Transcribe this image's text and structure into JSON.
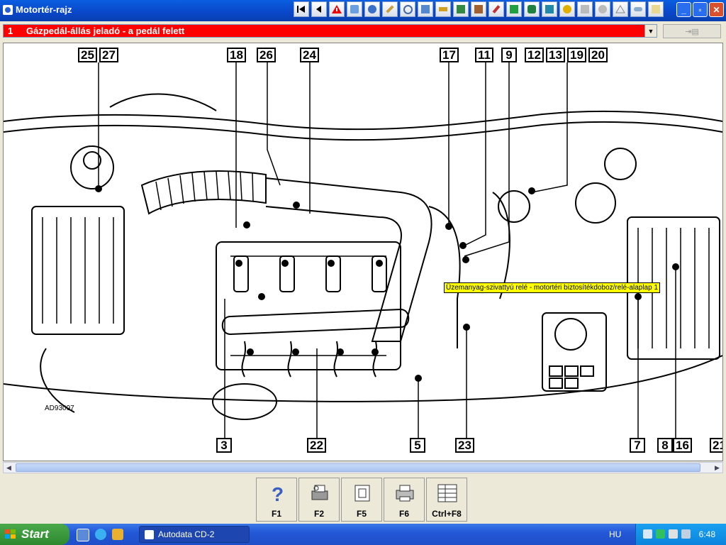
{
  "window": {
    "title": "Motortér-rajz"
  },
  "toolbar": {
    "icons": [
      "first-icon",
      "prev-icon",
      "warning-icon",
      "tool-icon",
      "gear-icon",
      "wrench-icon",
      "gauge-icon",
      "diagram-icon",
      "filter-icon",
      "battery-icon",
      "engine-icon",
      "pencil-icon",
      "relay-icon",
      "connector-icon",
      "circuit-icon",
      "key-icon",
      "hand-icon",
      "bulb-icon",
      "triangle-icon",
      "car-icon",
      "info-icon"
    ]
  },
  "window_buttons": {
    "minimize": "_",
    "maximize": "▫",
    "close": "✕"
  },
  "component_select": {
    "number": "1",
    "value": "Gázpedál-állás jeladó - a pedál felett"
  },
  "drawing": {
    "code": "AD93097",
    "labels_top": [
      "25",
      "27",
      "18",
      "26",
      "24",
      "17",
      "11",
      "9",
      "12",
      "13",
      "19",
      "20"
    ],
    "labels_bottom": [
      "3",
      "22",
      "5",
      "23",
      "7",
      "8",
      "16",
      "21"
    ],
    "tooltip": "Üzemanyag-szivattyú relé - motortéri biztosítékdoboz/relé-alaplap 1"
  },
  "function_keys": [
    {
      "label": "F1",
      "icon": "help-icon"
    },
    {
      "label": "F2",
      "icon": "print-preview-icon"
    },
    {
      "label": "F5",
      "icon": "component-icon"
    },
    {
      "label": "F6",
      "icon": "printer-icon"
    },
    {
      "label": "Ctrl+F8",
      "icon": "list-icon"
    }
  ],
  "taskbar": {
    "start": "Start",
    "app": "Autodata CD-2",
    "lang": "HU",
    "clock": "6:48"
  },
  "colors": {
    "title_bar": "#0a46c8",
    "selection_bg": "#ff0000",
    "tooltip_bg": "#ffff00",
    "taskbar": "#2458d8",
    "start_green": "#3b9a3b"
  }
}
